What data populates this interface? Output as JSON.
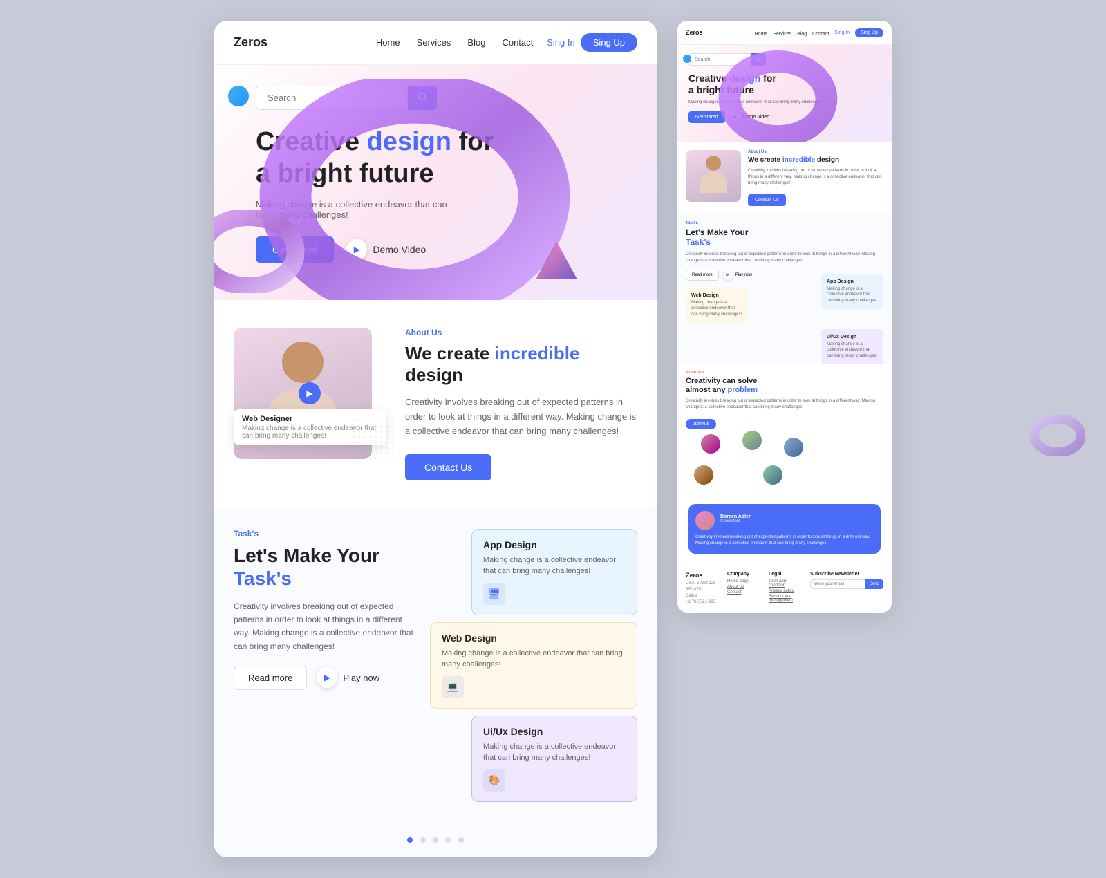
{
  "brand": {
    "name": "Zeros"
  },
  "nav": {
    "links": [
      "Home",
      "Services",
      "Blog",
      "Contact"
    ],
    "signin": "Sing In",
    "signup": "Sing Up"
  },
  "hero": {
    "search_placeholder": "Search",
    "title_part1": "Creative ",
    "title_accent": "design",
    "title_part2": " for",
    "title_line2": "a bright future",
    "subtitle": "Making change is a collective endeavor that can bring many challenges!",
    "btn_get_started": "Get stared",
    "btn_demo": "Demo Video"
  },
  "about": {
    "label": "About Us",
    "title_part1": "We create ",
    "title_accent": "incredible",
    "title_part2": " design",
    "text": "Creativity involves breaking out of expected patterns in order to look at things in a different way. Making change is a collective endeavor that can bring many challenges!",
    "btn_contact": "Contact Us",
    "tag_title": "Web Designer",
    "tag_sub": "Making change is a collective endeavor that can bring many challenges!"
  },
  "tasks": {
    "label": "Task's",
    "title_part1": "Let's Make Your",
    "title_line2_part1": "Task",
    "title_line2_accent": "'s",
    "text": "Creativity involves breaking out of expected patterns in order to look at things in a different way. Making change is a collective endeavor that can bring many challenges!",
    "btn_read": "Read more",
    "btn_play": "Play now",
    "cards": [
      {
        "title": "Web Design",
        "text": "Making change is a collective endeavor that can bring many challenges!",
        "type": "web"
      },
      {
        "title": "App Design",
        "text": "Making change is a collective endeavor that can bring many challenges!",
        "type": "app"
      },
      {
        "title": "Ui/Ux Design",
        "text": "Making change is a collective endeavor that can bring many challenges!",
        "type": "ui"
      }
    ]
  },
  "attention": {
    "label": "Attention",
    "title_part1": "Creativity can solve",
    "title_line2_part1": "almost any ",
    "title_accent": "problem",
    "text": "Creativity involves breaking out of expected patterns in order to look at things in a different way. Making change is a collective endeavor that can bring many challenges!",
    "btn_join": "Join#us"
  },
  "testimonial": {
    "name": "Doreen Adler",
    "role": "Consultant",
    "text": "Creativity involves breaking out of expected patterns in order to look at things in a different way. Making change is a collective endeavor that can bring many challenges!"
  },
  "footer": {
    "logo": "Zeros",
    "address": "USA, Street 125-352-875",
    "phone": "Callus +1(785)721-985",
    "company_heading": "Company",
    "company_links": [
      "Home page",
      "About Us",
      "Contact"
    ],
    "legal_heading": "Legal",
    "legal_links": [
      "Term and condition",
      "Privacy policy",
      "Security and management"
    ],
    "newsletter_heading": "Subscribe Newsletter",
    "newsletter_placeholder": "Write your email",
    "newsletter_btn": "Send"
  },
  "colors": {
    "accent": "#4a6cf7",
    "accent_text": "#4a6cf7"
  }
}
